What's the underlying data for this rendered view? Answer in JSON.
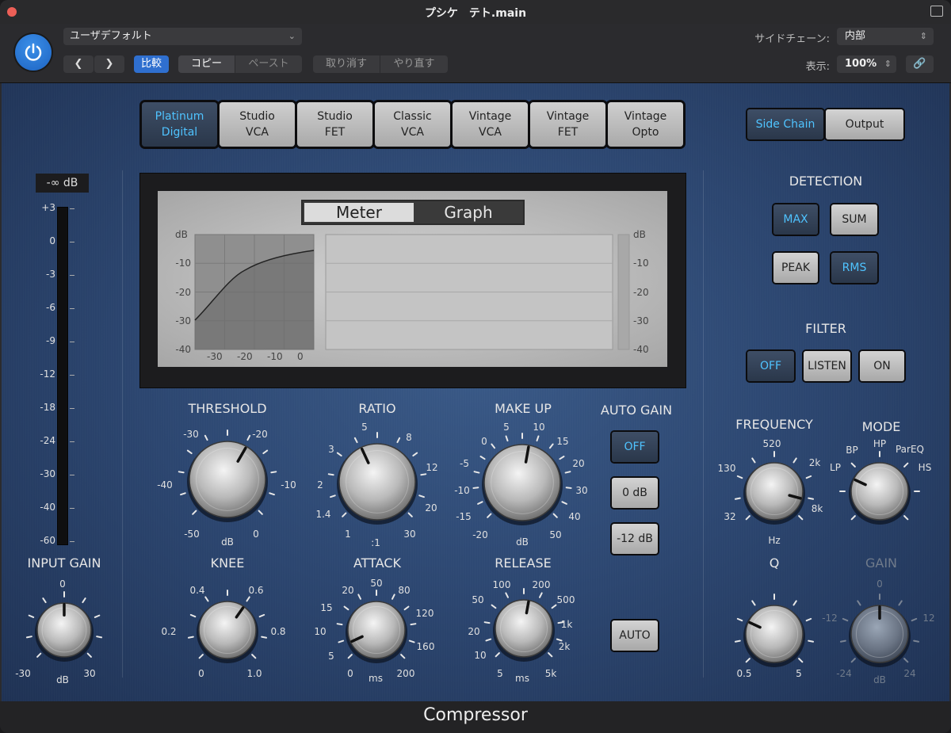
{
  "window": {
    "title": "プシケ　テト.main"
  },
  "header": {
    "preset": "ユーザデフォルト",
    "compare": "比較",
    "copy": "コピー",
    "paste": "ペースト",
    "undo": "取り消す",
    "redo": "やり直す",
    "sidechain_label": "サイドチェーン:",
    "sidechain_value": "内部",
    "view_label": "表示:",
    "view_value": "100%"
  },
  "models": [
    {
      "label": "Platinum\nDigital",
      "active": true
    },
    {
      "label": "Studio\nVCA",
      "active": false
    },
    {
      "label": "Studio\nFET",
      "active": false
    },
    {
      "label": "Classic\nVCA",
      "active": false
    },
    {
      "label": "Vintage\nVCA",
      "active": false
    },
    {
      "label": "Vintage\nFET",
      "active": false
    },
    {
      "label": "Vintage\nOpto",
      "active": false
    }
  ],
  "view_tabs": {
    "side_chain": "Side Chain",
    "output": "Output"
  },
  "display": {
    "meter_tab": "Meter",
    "graph_tab": "Graph",
    "db_label": "dB",
    "y_ticks": [
      "-10",
      "-20",
      "-30",
      "-40"
    ],
    "x_ticks": [
      "-30",
      "-20",
      "-10",
      "0"
    ],
    "right_ticks": [
      "-10",
      "-20",
      "-30",
      "-40"
    ]
  },
  "input_meter": {
    "readout": "-∞ dB",
    "scale": [
      "+3",
      "0",
      "-3",
      "-6",
      "-9",
      "-12",
      "-18",
      "-24",
      "-30",
      "-40",
      "-60"
    ]
  },
  "knobs": {
    "input_gain": {
      "label": "INPUT GAIN",
      "ticks": [
        "0",
        "-30",
        "30"
      ],
      "unit": "dB"
    },
    "threshold": {
      "label": "THRESHOLD",
      "ticks": [
        "-30",
        "-20",
        "-40",
        "-10",
        "-50",
        "0"
      ],
      "unit": "dB"
    },
    "ratio": {
      "label": "RATIO",
      "ticks": [
        "5",
        "8",
        "3",
        "12",
        "2",
        "20",
        "1.4",
        "30",
        "1"
      ],
      "unit": ":1"
    },
    "make_up": {
      "label": "MAKE UP",
      "ticks": [
        "5",
        "10",
        "0",
        "15",
        "-5",
        "20",
        "-10",
        "30",
        "-15",
        "40",
        "-20",
        "50"
      ],
      "unit": "dB"
    },
    "knee": {
      "label": "KNEE",
      "ticks": [
        "0.4",
        "0.6",
        "0.2",
        "0.8",
        "0",
        "1.0"
      ]
    },
    "attack": {
      "label": "ATTACK",
      "ticks": [
        "20",
        "50",
        "80",
        "15",
        "120",
        "10",
        "5",
        "160",
        "0",
        "200"
      ],
      "unit": "ms"
    },
    "release": {
      "label": "RELEASE",
      "ticks": [
        "100",
        "200",
        "50",
        "500",
        "20",
        "1k",
        "10",
        "2k",
        "5",
        "5k"
      ],
      "unit": "ms"
    },
    "frequency": {
      "label": "FREQUENCY",
      "ticks": [
        "520",
        "130",
        "2k",
        "32",
        "8k"
      ],
      "unit": "Hz"
    },
    "mode": {
      "label": "MODE",
      "ticks": [
        "HP",
        "BP",
        "ParEQ",
        "LP",
        "HS"
      ]
    },
    "q": {
      "label": "Q",
      "ticks": [
        "0.5",
        "5"
      ]
    },
    "gain": {
      "label": "GAIN",
      "ticks": [
        "0",
        "-12",
        "12",
        "-24",
        "24"
      ],
      "unit": "dB"
    }
  },
  "auto_gain": {
    "label": "AUTO GAIN",
    "off": "OFF",
    "zero": "0 dB",
    "minus12": "-12 dB",
    "auto": "AUTO"
  },
  "detection": {
    "label": "DETECTION",
    "max": "MAX",
    "sum": "SUM",
    "peak": "PEAK",
    "rms": "RMS"
  },
  "filter": {
    "label": "FILTER",
    "off": "OFF",
    "listen": "LISTEN",
    "on": "ON"
  },
  "footer": {
    "title": "Compressor"
  }
}
